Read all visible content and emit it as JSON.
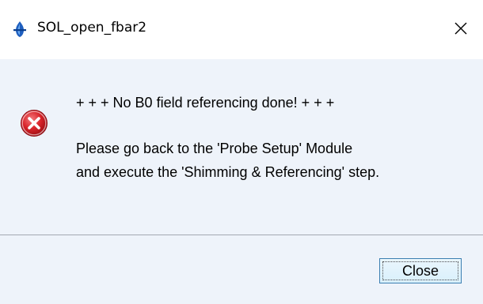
{
  "window": {
    "title": "SOL_open_fbar2",
    "app_icon": "bruker-app-icon",
    "close_icon": "close-icon"
  },
  "message": {
    "icon": "error-icon",
    "line1": "+ + + No B0 field referencing done! + + +",
    "line2": "Please go back to the 'Probe Setup' Module",
    "line3": "and execute the 'Shimming & Referencing' step."
  },
  "buttons": {
    "close_label": "Close"
  },
  "colors": {
    "content_bg": "#eef3fa",
    "error_red": "#d9242a",
    "button_border": "#3c7fb1"
  }
}
